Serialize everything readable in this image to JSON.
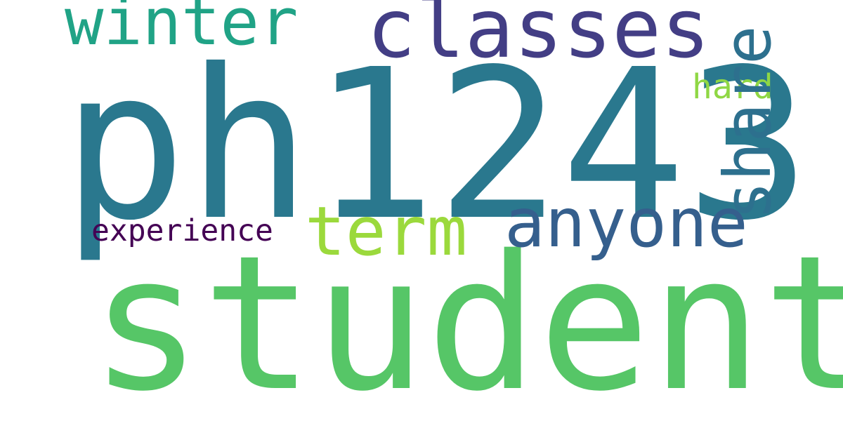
{
  "words": [
    {
      "id": "ph1243",
      "text": "ph1243",
      "color": "#2a788e"
    },
    {
      "id": "student",
      "text": "student",
      "color": "#56c667"
    },
    {
      "id": "winter",
      "text": "winter",
      "color": "#20a386"
    },
    {
      "id": "classes",
      "text": "classes",
      "color": "#433e85"
    },
    {
      "id": "term",
      "text": "term",
      "color": "#9bd93c"
    },
    {
      "id": "anyone",
      "text": "anyone",
      "color": "#355f8d"
    },
    {
      "id": "experience",
      "text": "experience",
      "color": "#440154"
    },
    {
      "id": "hard",
      "text": "hard",
      "color": "#8fd744"
    },
    {
      "id": "share",
      "text": "share",
      "color": "#2d708e"
    }
  ]
}
